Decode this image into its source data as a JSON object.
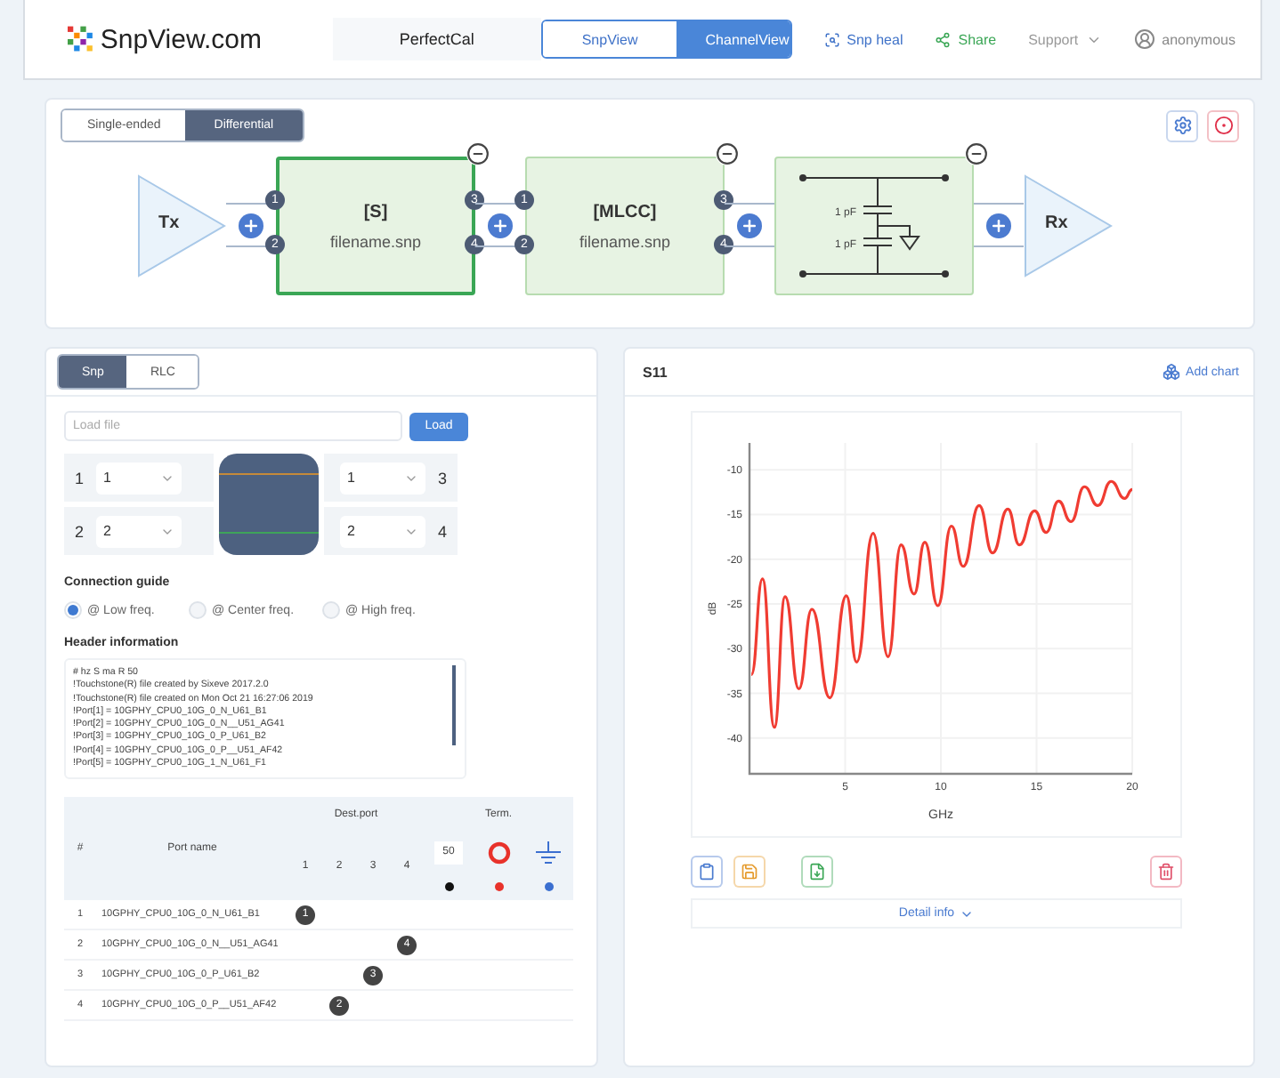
{
  "header": {
    "brand": "SnpView.com",
    "project": "PerfectCal",
    "views": [
      {
        "label": "SnpView",
        "selected": false
      },
      {
        "label": "ChannelView",
        "selected": true
      }
    ],
    "links": [
      {
        "kind": "heal",
        "label": "Snp heal"
      },
      {
        "kind": "share",
        "label": "Share"
      },
      {
        "kind": "menu",
        "label": "Support"
      },
      {
        "kind": "user",
        "label": "anonymous"
      }
    ]
  },
  "channel": {
    "modes": [
      {
        "label": "Single-ended",
        "selected": false
      },
      {
        "label": "Differential",
        "selected": true
      }
    ],
    "tx": "Tx",
    "rx": "Rx",
    "blocks": [
      {
        "kind": "snp",
        "title": "[S]",
        "file": "filename.snp",
        "selected": true,
        "ports": [
          "1",
          "2",
          "3",
          "4"
        ]
      },
      {
        "kind": "snp",
        "title": "[MLCC]",
        "file": "filename.snp",
        "selected": false,
        "ports": [
          "1",
          "2",
          "3",
          "4"
        ]
      },
      {
        "kind": "circuit",
        "selected": false,
        "values": [
          "1 pF",
          "1 pF"
        ]
      }
    ]
  },
  "snp_panel": {
    "tabs": [
      {
        "label": "Snp",
        "selected": true
      },
      {
        "label": "RLC",
        "selected": false
      }
    ],
    "load": {
      "placeholder": "Load file",
      "button": "Load"
    },
    "ports": [
      {
        "left_label": "1",
        "left_value": "1",
        "right_value": "1",
        "right_label": "3"
      },
      {
        "left_label": "2",
        "left_value": "2",
        "right_value": "2",
        "right_label": "4"
      }
    ],
    "guide": {
      "title": "Connection guide",
      "options": [
        {
          "label": "@ Low freq.",
          "selected": true
        },
        {
          "label": "@ Center freq.",
          "selected": false
        },
        {
          "label": "@ High freq.",
          "selected": false
        }
      ]
    },
    "header_info": {
      "title": "Header information",
      "lines": [
        "# hz S ma R 50",
        "!Touchstone(R) file created by Sixeve 2017.2.0",
        "!Touchstone(R) file created on Mon Oct 21 16:27:06 2019",
        "!Port[1] = 10GPHY_CPU0_10G_0_N_U61_B1",
        "!Port[2] = 10GPHY_CPU0_10G_0_N__U51_AG41",
        "!Port[3] = 10GPHY_CPU0_10G_0_P_U61_B2",
        "!Port[4] = 10GPHY_CPU0_10G_0_P__U51_AF42",
        "!Port[5] = 10GPHY_CPU0_10G_1_N_U61_F1"
      ]
    },
    "table": {
      "index_header": "#",
      "name_header": "Port name",
      "dest_header": "Dest.port",
      "dest_ports": [
        "1",
        "2",
        "3",
        "4"
      ],
      "term_header": "Term.",
      "terminations": [
        {
          "kind": "resistor",
          "value": "50",
          "color": "#111111"
        },
        {
          "kind": "open",
          "color": "#e8322b"
        },
        {
          "kind": "ground",
          "color": "#3b6fd0"
        }
      ],
      "rows": [
        {
          "index": "1",
          "name": "10GPHY_CPU0_10G_0_N_U61_B1",
          "dest": [
            {
              "selected": true,
              "label": "1"
            },
            {
              "selected": false
            },
            {
              "selected": false
            },
            {
              "selected": false
            }
          ]
        },
        {
          "index": "2",
          "name": "10GPHY_CPU0_10G_0_N__U51_AG41",
          "dest": [
            {
              "selected": false
            },
            {
              "selected": false
            },
            {
              "selected": false
            },
            {
              "selected": true,
              "label": "4"
            }
          ]
        },
        {
          "index": "3",
          "name": "10GPHY_CPU0_10G_0_P_U61_B2",
          "dest": [
            {
              "selected": false
            },
            {
              "selected": false
            },
            {
              "selected": true,
              "label": "3"
            },
            {
              "selected": false
            }
          ]
        },
        {
          "index": "4",
          "name": "10GPHY_CPU0_10G_0_P__U51_AF42",
          "dest": [
            {
              "selected": false
            },
            {
              "selected": true,
              "label": "2"
            },
            {
              "selected": false
            },
            {
              "selected": false
            }
          ]
        }
      ]
    }
  },
  "chart_panel": {
    "title": "S11",
    "add": "Add chart",
    "chart_data": {
      "type": "line",
      "xlabel": "GHz",
      "ylabel": "dB",
      "xlim": [
        0,
        20
      ],
      "ylim": [
        -44,
        -7
      ],
      "xticks": [
        5,
        10,
        15,
        20
      ],
      "yticks": [
        -10,
        -15,
        -20,
        -25,
        -30,
        -35,
        -40
      ],
      "x": [
        0.1,
        0.68,
        1.3,
        1.86,
        2.58,
        3.26,
        4.2,
        5.06,
        5.6,
        6.46,
        7.24,
        7.92,
        8.6,
        9.16,
        9.84,
        10.55,
        11.17,
        12.0,
        12.7,
        13.5,
        14.1,
        14.9,
        15.5,
        16.15,
        16.8,
        17.5,
        18.2,
        18.9,
        19.6,
        20
      ],
      "grid": true,
      "series": [
        {
          "color": "#f03c32",
          "values": [
            -32.9,
            -22.2,
            -38.8,
            -24.2,
            -34.5,
            -25.6,
            -35.5,
            -24.1,
            -31.5,
            -17.1,
            -30.9,
            -18.4,
            -23.9,
            -18.1,
            -25.2,
            -16.3,
            -20.8,
            -14.0,
            -19.3,
            -14.4,
            -18.4,
            -14.6,
            -17.0,
            -13.5,
            -15.8,
            -11.9,
            -14.0,
            -11.3,
            -13.2,
            -12.2
          ]
        }
      ]
    },
    "actions": [
      {
        "kind": "copy"
      },
      {
        "kind": "save"
      },
      {
        "kind": "export"
      },
      {
        "kind": "delete"
      }
    ],
    "detail": "Detail info"
  }
}
